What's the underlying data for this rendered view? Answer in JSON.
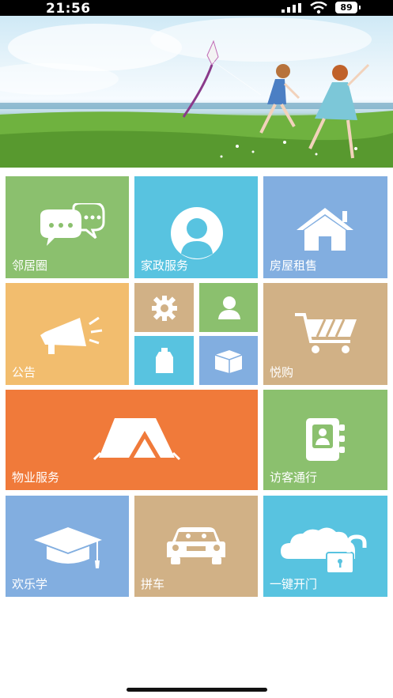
{
  "status_bar": {
    "time": "21:56",
    "battery": "89"
  },
  "tiles": {
    "neighbors": {
      "label": "邻居圈"
    },
    "housekeeping": {
      "label": "家政服务"
    },
    "rental": {
      "label": "房屋租售"
    },
    "notice": {
      "label": "公告"
    },
    "shopping": {
      "label": "悦购"
    },
    "property": {
      "label": "物业服务"
    },
    "visitor": {
      "label": "访客通行"
    },
    "learning": {
      "label": "欢乐学"
    },
    "carpool": {
      "label": "拼车"
    },
    "unlock": {
      "label": "一键开门"
    }
  },
  "colors": {
    "green": "#8bc06e",
    "sky": "#58c3e0",
    "blue": "#82aee0",
    "orange": "#f2bd6e",
    "tan": "#d1b186",
    "deep_orange": "#f07a3a"
  }
}
